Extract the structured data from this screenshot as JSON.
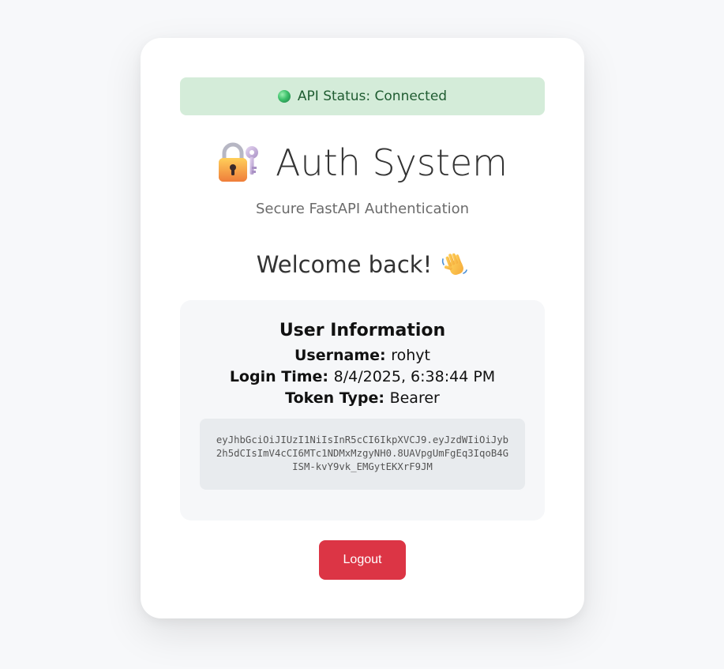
{
  "status": {
    "text": "API Status: Connected",
    "indicator_color": "#3cc06a"
  },
  "header": {
    "title": "Auth System",
    "subtitle": "Secure FastAPI Authentication",
    "icon": "locked-with-key-icon"
  },
  "welcome": {
    "text": "Welcome back!",
    "icon": "waving-hand-icon"
  },
  "user_info": {
    "title": "User Information",
    "username_label": "Username:",
    "username": "rohyt",
    "login_time_label": "Login Time:",
    "login_time": "8/4/2025, 6:38:44 PM",
    "token_type_label": "Token Type:",
    "token_type": "Bearer",
    "token": "eyJhbGciOiJIUzI1NiIsInR5cCI6IkpXVCJ9.eyJzdWIiOiJyb2h5dCIsImV4cCI6MTc1NDMxMzgyNH0.8UAVpgUmFgEq3IqoB4GISM-kvY9vk_EMGytEKXrF9JM"
  },
  "actions": {
    "logout_label": "Logout"
  },
  "colors": {
    "status_bg": "#d4ecd9",
    "status_text": "#1f5c31",
    "logout_bg": "#dc3545",
    "info_bg": "#f6f7f9",
    "token_bg": "#e8ebee"
  }
}
